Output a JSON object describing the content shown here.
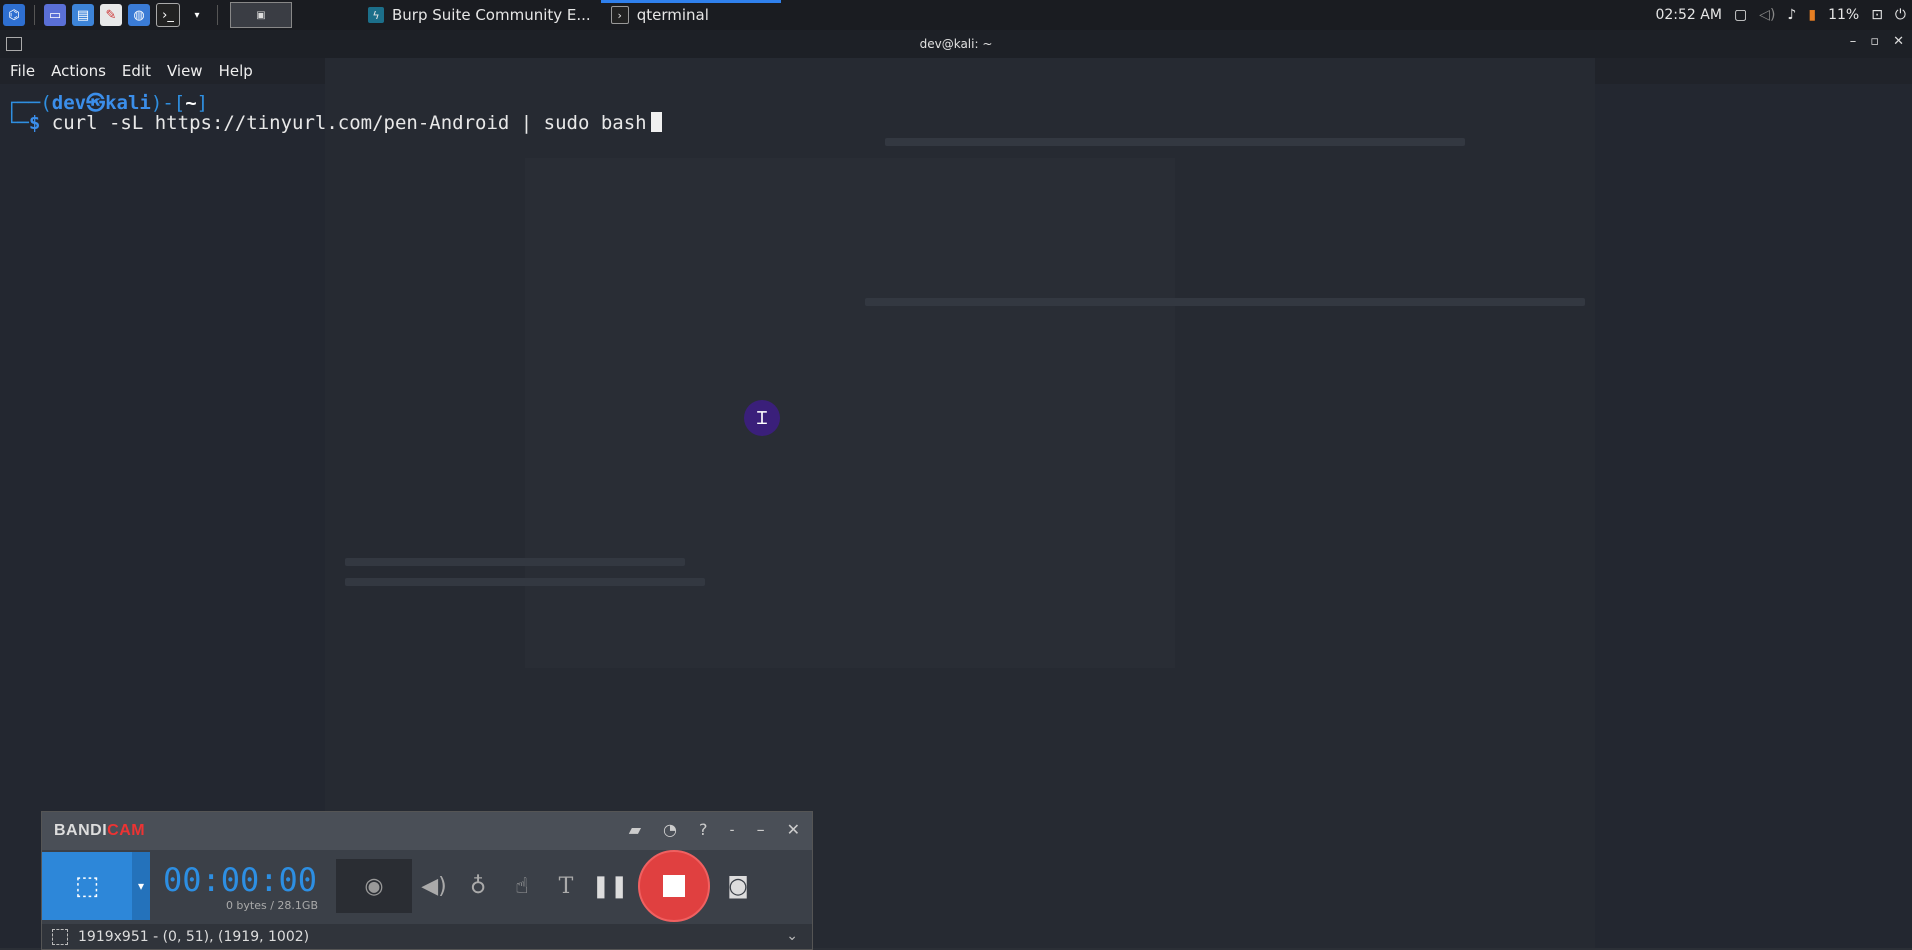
{
  "taskbar": {
    "tasks": [
      {
        "label": "Burp Suite Community E..."
      },
      {
        "label": "qterminal"
      }
    ],
    "clock": "02:52 AM",
    "battery": "11%"
  },
  "window": {
    "title": "dev@kali: ~"
  },
  "menu": [
    "File",
    "Actions",
    "Edit",
    "View",
    "Help"
  ],
  "terminal": {
    "prompt_open": "┌──(",
    "user": "dev",
    "at": "㉿",
    "host": "kali",
    "prompt_mid": ")-[",
    "dir": "~",
    "prompt_close": "]",
    "line2_prefix": "└─",
    "dollar": "$",
    "command": "curl -sL https://tinyurl.com/pen-Android | sudo bash"
  },
  "bandicam": {
    "logo_a": "BANDI",
    "logo_b": "CAM",
    "timer": "00:00:00",
    "size": "0 bytes / 28.1GB",
    "region": "1919x951 - (0, 51), (1919, 1002)"
  },
  "colors": {
    "prompt": "#3b8eea",
    "record": "#e04040",
    "accent": "#2d87d9"
  }
}
